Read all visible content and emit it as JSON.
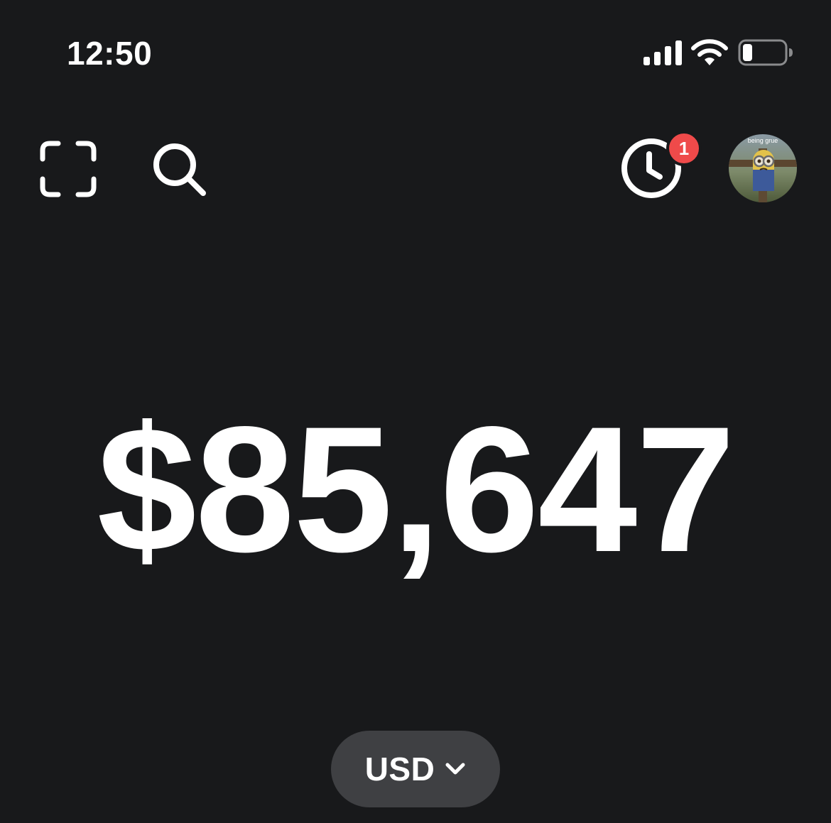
{
  "status_bar": {
    "time": "12:50",
    "icons": [
      "cellular-signal-icon",
      "wifi-icon",
      "battery-icon"
    ],
    "battery_level_percent": 20
  },
  "toolbar": {
    "left_icons": [
      "scan-qr-icon",
      "search-icon"
    ],
    "right_icons": [
      "activity-clock-icon",
      "profile-avatar"
    ],
    "activity_badge_count": "1",
    "avatar_caption": "being grue"
  },
  "balance": {
    "amount": "$85,647"
  },
  "currency_selector": {
    "label": "USD",
    "icon": "chevron-down-icon"
  },
  "colors": {
    "background": "#18191b",
    "foreground": "#ffffff",
    "badge": "#ef4a4a",
    "pill": "#3f4043"
  }
}
